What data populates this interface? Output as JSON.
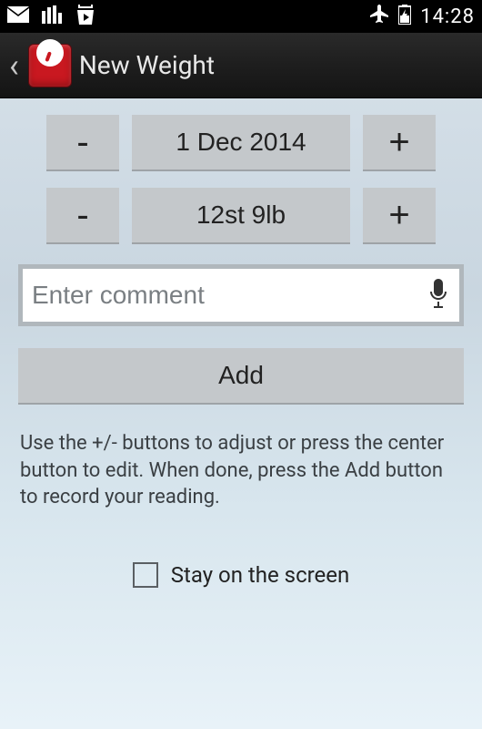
{
  "status": {
    "time": "14:28"
  },
  "appbar": {
    "title": "New Weight"
  },
  "date_row": {
    "minus": "-",
    "value": "1 Dec 2014",
    "plus": "+"
  },
  "weight_row": {
    "minus": "-",
    "value": "12st 9lb",
    "plus": "+"
  },
  "comment": {
    "placeholder": "Enter comment",
    "value": ""
  },
  "add_button": "Add",
  "hint": "Use the +/- buttons to adjust or press the center button to edit. When done, press the Add button to record your reading.",
  "stay_checkbox": {
    "label": "Stay on the screen",
    "checked": false
  }
}
